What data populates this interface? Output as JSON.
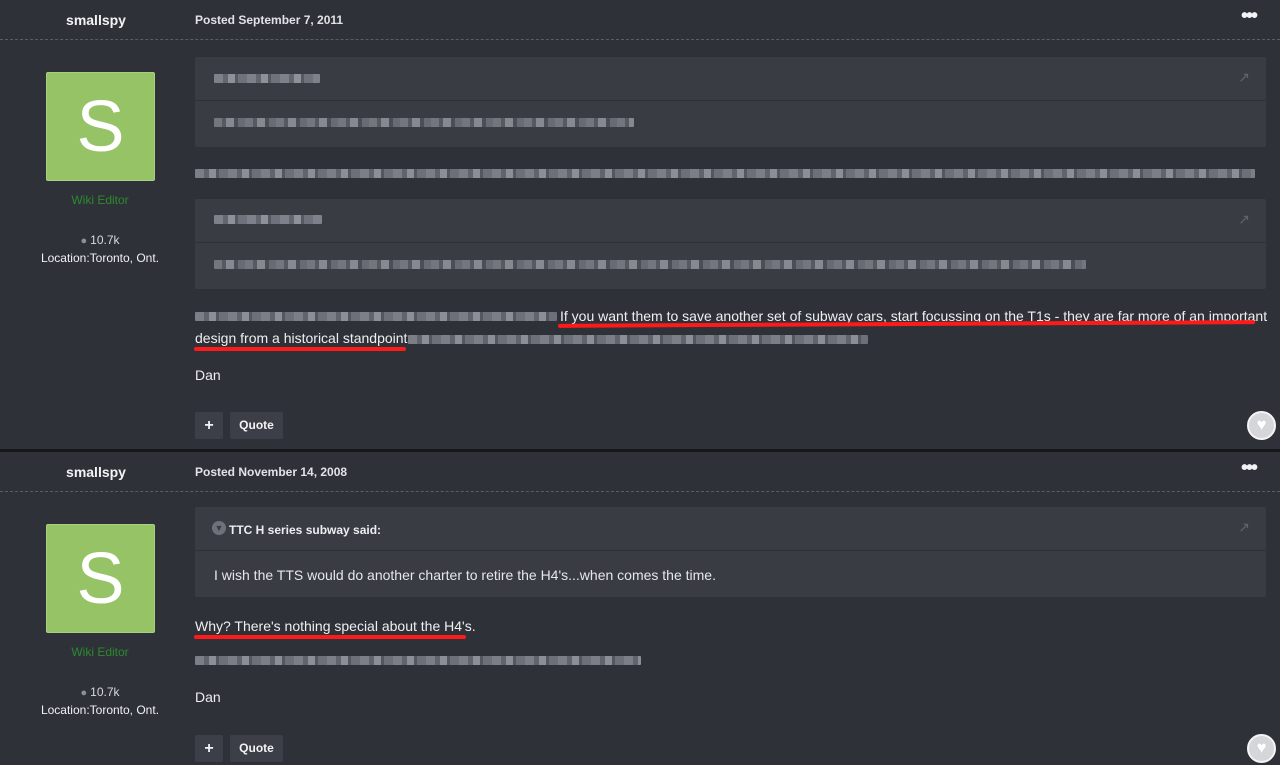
{
  "posts": [
    {
      "author": "smallspy",
      "posted": "Posted September 7, 2011",
      "menu_icon": "•••",
      "avatar_letter": "S",
      "rank": "Wiki Editor",
      "post_count": "10.7k",
      "location": "Location:Toronto, Ont.",
      "highlight_line1": "If you want them to save another set of subway cars, start focussing on the T1s - they are far more of an important",
      "highlight_line2": "design from a historical standpoint",
      "signature": "Dan",
      "plus_label": "+",
      "quote_label": "Quote"
    },
    {
      "author": "smallspy",
      "posted": "Posted November 14, 2008",
      "menu_icon": "•••",
      "avatar_letter": "S",
      "rank": "Wiki Editor",
      "post_count": "10.7k",
      "location": "Location:Toronto, Ont.",
      "quote_citation": "TTC H series subway said:",
      "quote_text": "I wish the TTS would do another charter to retire the H4's...when comes the time.",
      "highlight_line1": "Why? There's nothing special about the H4's.",
      "signature": "Dan",
      "plus_label": "+",
      "quote_label": "Quote"
    }
  ],
  "icons": {
    "comment": "comment-icon",
    "reaction": "heart-icon",
    "quote_toggle": "chevron-down-icon",
    "share": "share-icon"
  },
  "colors": {
    "background": "#2f3139",
    "quote_bg": "#3a3c44",
    "avatar_bg": "#95c365",
    "rank": "#2c8a2c",
    "annotation": "#ff1a1a"
  }
}
